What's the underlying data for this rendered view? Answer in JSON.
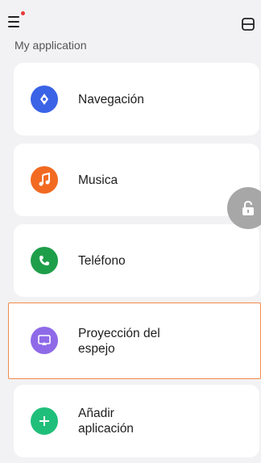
{
  "header": {
    "menu_icon": "menu-icon",
    "has_notification": true,
    "switch_icon": "switch-icon"
  },
  "section_title": "My application",
  "apps": [
    {
      "label": "Navegación",
      "icon": "navigation-icon",
      "color": "#3b63e6"
    },
    {
      "label": "Musica",
      "icon": "music-icon",
      "color": "#f26a21"
    },
    {
      "label": "Teléfono",
      "icon": "phone-icon",
      "color": "#1f9e4a"
    },
    {
      "label": "Proyección del\nespejo",
      "icon": "screen-mirror-icon",
      "color": "#8f6ae8",
      "selected": true
    },
    {
      "label": "Añadir\naplicación",
      "icon": "add-icon",
      "color": "#1fbf7a"
    }
  ],
  "floating": {
    "icon": "lock-open-icon"
  }
}
